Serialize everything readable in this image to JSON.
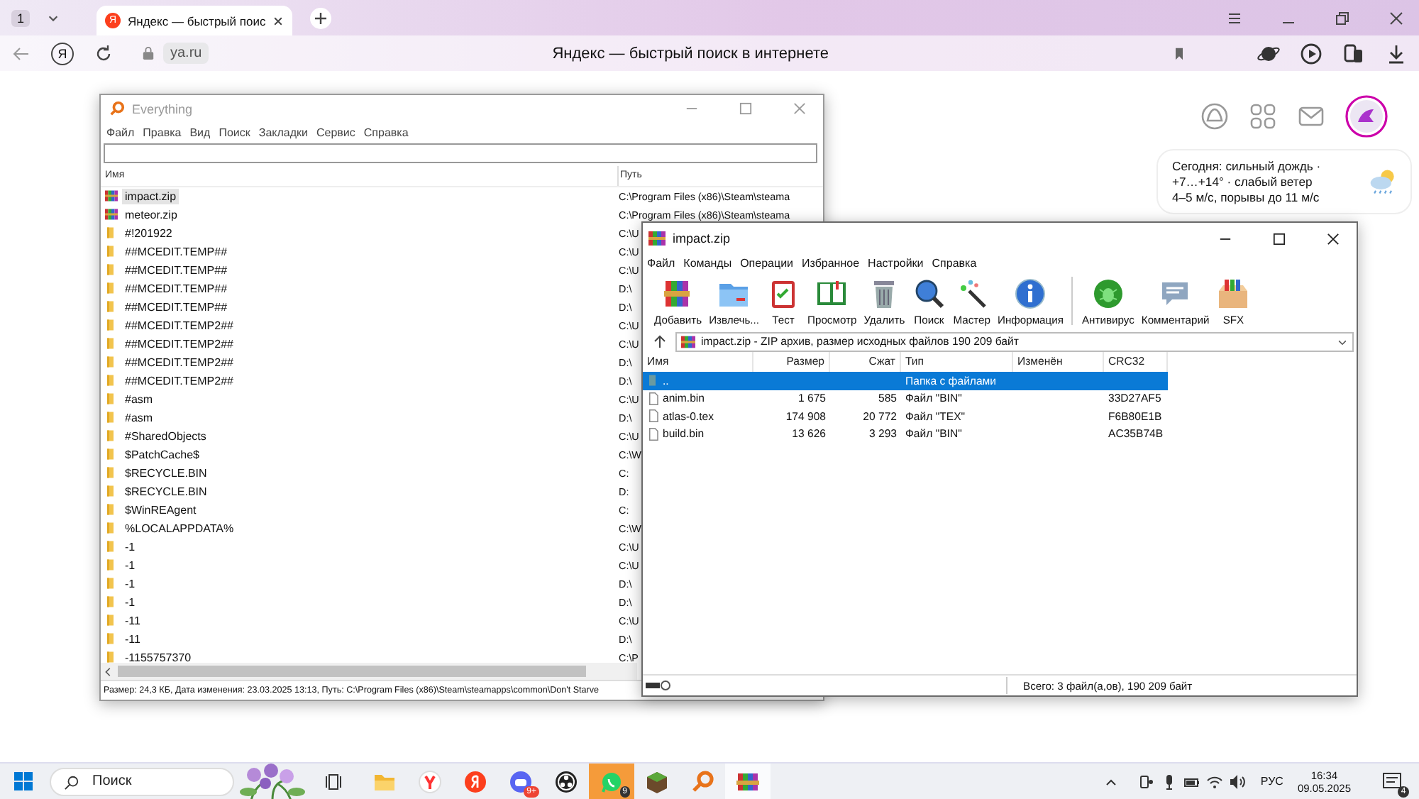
{
  "browser": {
    "tab_count": "1",
    "tab": {
      "favicon": "Я",
      "title": "Яндекс — быстрый поис"
    },
    "profile_letter": "Я",
    "url": "ya.ru",
    "page_title": "Яндекс — быстрый поиск в интернете"
  },
  "page": {
    "weather": [
      "Сегодня: сильный дождь ·",
      "+7…+14° · слабый ветер",
      "4–5 м/с, порывы до 11 м/с"
    ]
  },
  "everything": {
    "title": "Everything",
    "menu": [
      "Файл",
      "Правка",
      "Вид",
      "Поиск",
      "Закладки",
      "Сервис",
      "Справка"
    ],
    "columns": [
      "Имя",
      "Путь"
    ],
    "rows": [
      {
        "name": "impact.zip",
        "path": "C:\\Program Files (x86)\\Steam\\steama",
        "kind": "zip",
        "selected": true
      },
      {
        "name": "meteor.zip",
        "path": "C:\\Program Files (x86)\\Steam\\steama",
        "kind": "zip",
        "selected": false
      },
      {
        "name": "#!201922",
        "path": "C:\\U",
        "kind": "folder",
        "selected": false
      },
      {
        "name": "##MCEDIT.TEMP##",
        "path": "C:\\U",
        "kind": "folder",
        "selected": false
      },
      {
        "name": "##MCEDIT.TEMP##",
        "path": "C:\\U",
        "kind": "folder",
        "selected": false
      },
      {
        "name": "##MCEDIT.TEMP##",
        "path": "D:\\",
        "kind": "folder",
        "selected": false
      },
      {
        "name": "##MCEDIT.TEMP##",
        "path": "D:\\",
        "kind": "folder",
        "selected": false
      },
      {
        "name": "##MCEDIT.TEMP2##",
        "path": "C:\\U",
        "kind": "folder",
        "selected": false
      },
      {
        "name": "##MCEDIT.TEMP2##",
        "path": "C:\\U",
        "kind": "folder",
        "selected": false
      },
      {
        "name": "##MCEDIT.TEMP2##",
        "path": "D:\\",
        "kind": "folder",
        "selected": false
      },
      {
        "name": "##MCEDIT.TEMP2##",
        "path": "D:\\",
        "kind": "folder",
        "selected": false
      },
      {
        "name": "#asm",
        "path": "C:\\U",
        "kind": "folder",
        "selected": false
      },
      {
        "name": "#asm",
        "path": "D:\\",
        "kind": "folder",
        "selected": false
      },
      {
        "name": "#SharedObjects",
        "path": "C:\\U",
        "kind": "folder",
        "selected": false
      },
      {
        "name": "$PatchCache$",
        "path": "C:\\W",
        "kind": "folder",
        "selected": false
      },
      {
        "name": "$RECYCLE.BIN",
        "path": "C:",
        "kind": "folder",
        "selected": false
      },
      {
        "name": "$RECYCLE.BIN",
        "path": "D:",
        "kind": "folder",
        "selected": false
      },
      {
        "name": "$WinREAgent",
        "path": "C:",
        "kind": "folder",
        "selected": false
      },
      {
        "name": "%LOCALAPPDATA%",
        "path": "C:\\W",
        "kind": "folder",
        "selected": false
      },
      {
        "name": "-1",
        "path": "C:\\U",
        "kind": "folder",
        "selected": false
      },
      {
        "name": "-1",
        "path": "C:\\U",
        "kind": "folder",
        "selected": false
      },
      {
        "name": "-1",
        "path": "D:\\",
        "kind": "folder",
        "selected": false
      },
      {
        "name": "-1",
        "path": "D:\\",
        "kind": "folder",
        "selected": false
      },
      {
        "name": "-11",
        "path": "C:\\U",
        "kind": "folder",
        "selected": false
      },
      {
        "name": "-11",
        "path": "D:\\",
        "kind": "folder",
        "selected": false
      },
      {
        "name": "-1155757370",
        "path": "C:\\P",
        "kind": "folder",
        "selected": false
      }
    ],
    "status": "Размер: 24,3 КБ, Дата изменения: 23.03.2025 13:13, Путь: C:\\Program Files (x86)\\Steam\\steamapps\\common\\Don't Starve"
  },
  "winrar": {
    "title": "impact.zip",
    "menu": [
      "Файл",
      "Команды",
      "Операции",
      "Избранное",
      "Настройки",
      "Справка"
    ],
    "toolbar": [
      "Добавить",
      "Извлечь...",
      "Тест",
      "Просмотр",
      "Удалить",
      "Поиск",
      "Мастер",
      "Информация",
      "Антивирус",
      "Комментарий",
      "SFX"
    ],
    "address": "impact.zip - ZIP архив, размер исходных файлов 190 209 байт",
    "columns": [
      "Имя",
      "Размер",
      "Сжат",
      "Тип",
      "Изменён",
      "CRC32"
    ],
    "rows": [
      {
        "name": "..",
        "type": "Папка с файлами",
        "kind": "up",
        "selected": true
      },
      {
        "name": "anim.bin",
        "size": "1 675",
        "packed": "585",
        "type": "Файл \"BIN\"",
        "crc": "33D27AF5",
        "kind": "file",
        "selected": false
      },
      {
        "name": "atlas-0.tex",
        "size": "174 908",
        "packed": "20 772",
        "type": "Файл \"TEX\"",
        "crc": "F6B80E1B",
        "kind": "file",
        "selected": false
      },
      {
        "name": "build.bin",
        "size": "13 626",
        "packed": "3 293",
        "type": "Файл \"BIN\"",
        "crc": "AC35B74B",
        "kind": "file",
        "selected": false
      }
    ],
    "status": "Всего: 3 файл(а,ов), 190 209 байт"
  },
  "taskbar": {
    "search_placeholder": "Поиск",
    "discord_badge": "9+",
    "whatsapp_badge": "9",
    "language": "РУС",
    "time": "16:34",
    "date": "09.05.2025",
    "notifications": "4"
  }
}
